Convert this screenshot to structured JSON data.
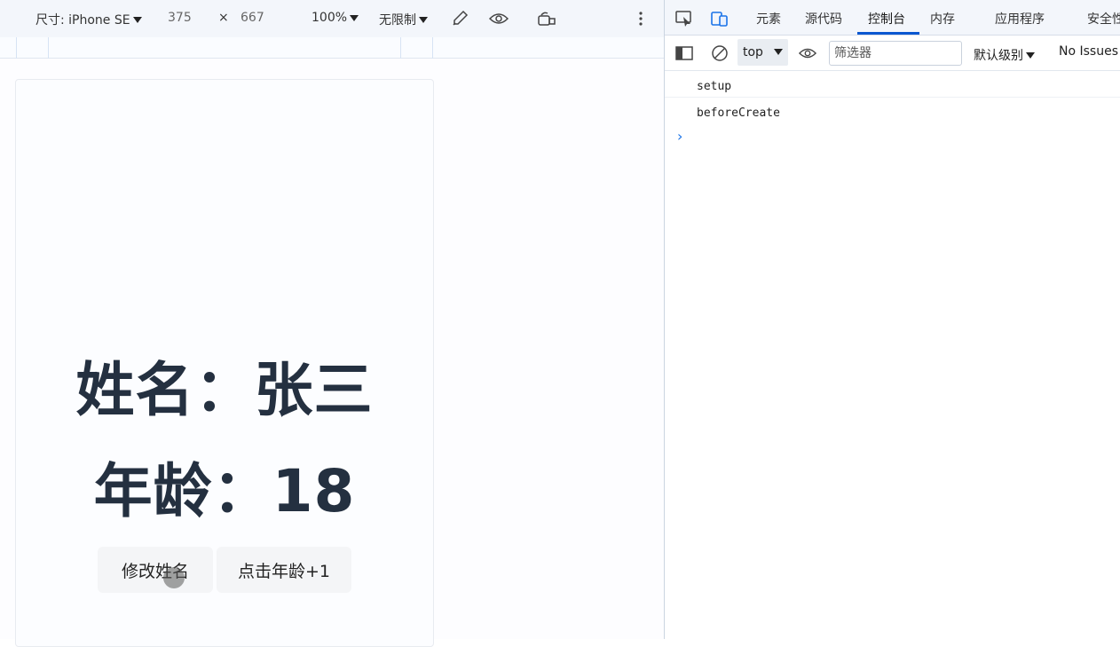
{
  "device_toolbar": {
    "dimensions_label": "尺寸: iPhone SE",
    "width": "375",
    "times": "×",
    "height": "667",
    "zoom": "100%",
    "throttle": "无限制"
  },
  "app": {
    "name_label": "姓名：",
    "name_value": "张三",
    "age_label": "年龄：",
    "age_value": "18",
    "buttons": {
      "change_name": "修改姓名",
      "age_plus": "点击年龄+1"
    }
  },
  "devtools": {
    "tabs": [
      {
        "label": "元素",
        "active": false
      },
      {
        "label": "源代码",
        "active": false
      },
      {
        "label": "控制台",
        "active": true
      },
      {
        "label": "内存",
        "active": false
      },
      {
        "label": "应用程序",
        "active": false
      },
      {
        "label": "安全性",
        "active": false
      }
    ],
    "console_toolbar": {
      "context": "top",
      "filter_placeholder": "筛选器",
      "level": "默认级别",
      "issues": "No Issues"
    },
    "console_lines": [
      "setup",
      "beforeCreate"
    ],
    "prompt": "›"
  },
  "colors": {
    "accent": "#0b57d0",
    "heading_text": "#243040",
    "prompt": "#1a73e8"
  }
}
